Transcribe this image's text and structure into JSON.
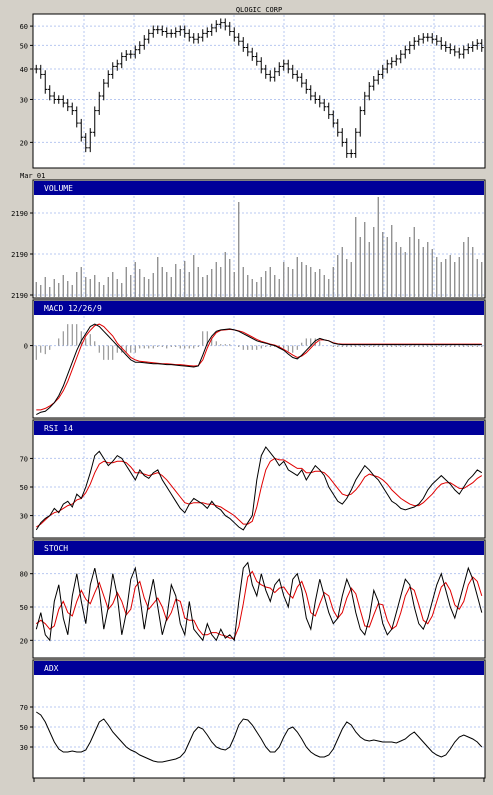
{
  "title": "QLOGIC CORP",
  "x_start_label": "Mar 01",
  "colors": {
    "panel_bg": "#ffffff",
    "header_bg": "#000099",
    "header_text": "#ffffff",
    "grid": "#b8c8f0",
    "price": "#000000",
    "signal": "#e00000",
    "volume": "#808080",
    "frame_bg": "#d4d0c8"
  },
  "chart_data": [
    {
      "type": "line",
      "name": "price",
      "style": "ohlc-bars",
      "title": "QLOGIC CORP",
      "yscale": "log",
      "ylim": [
        16,
        66
      ],
      "yticks": [
        20,
        30,
        40,
        50,
        60
      ],
      "x_count": 100,
      "values": [
        40,
        38,
        33,
        31,
        30,
        30,
        29,
        28,
        27,
        24,
        21,
        19,
        22,
        27,
        31,
        35,
        38,
        41,
        42,
        45,
        46,
        46,
        48,
        50,
        53,
        56,
        58,
        58,
        57,
        56,
        56,
        57,
        58,
        56,
        54,
        53,
        54,
        56,
        57,
        59,
        61,
        62,
        60,
        57,
        54,
        52,
        49,
        47,
        45,
        43,
        40,
        38,
        37,
        39,
        41,
        42,
        40,
        38,
        37,
        35,
        33,
        31,
        30,
        29,
        28,
        26,
        24,
        22,
        20,
        18,
        18,
        22,
        27,
        31,
        34,
        36,
        38,
        40,
        42,
        43,
        44,
        46,
        48,
        50,
        52,
        53,
        54,
        54,
        53,
        52,
        50,
        49,
        48,
        47,
        46,
        48,
        49,
        50,
        51,
        49
      ]
    },
    {
      "type": "bar",
      "name": "volume",
      "header": "VOLUME",
      "yticks": [
        "2190",
        "2190",
        "2190"
      ],
      "x_count": 100,
      "values": [
        0.15,
        0.12,
        0.2,
        0.1,
        0.18,
        0.14,
        0.22,
        0.16,
        0.12,
        0.25,
        0.3,
        0.2,
        0.18,
        0.22,
        0.15,
        0.12,
        0.2,
        0.25,
        0.18,
        0.14,
        0.3,
        0.22,
        0.35,
        0.28,
        0.2,
        0.18,
        0.24,
        0.4,
        0.3,
        0.25,
        0.2,
        0.33,
        0.28,
        0.36,
        0.25,
        0.42,
        0.3,
        0.2,
        0.22,
        0.28,
        0.35,
        0.3,
        0.45,
        0.38,
        0.25,
        0.95,
        0.3,
        0.22,
        0.18,
        0.15,
        0.2,
        0.26,
        0.3,
        0.22,
        0.18,
        0.35,
        0.3,
        0.28,
        0.4,
        0.35,
        0.32,
        0.3,
        0.25,
        0.28,
        0.22,
        0.18,
        0.3,
        0.42,
        0.5,
        0.38,
        0.35,
        0.8,
        0.6,
        0.75,
        0.55,
        0.7,
        1.0,
        0.65,
        0.6,
        0.72,
        0.55,
        0.5,
        0.45,
        0.6,
        0.7,
        0.58,
        0.5,
        0.55,
        0.48,
        0.4,
        0.35,
        0.38,
        0.42,
        0.35,
        0.4,
        0.55,
        0.6,
        0.5,
        0.38,
        0.35
      ]
    },
    {
      "type": "line",
      "name": "macd",
      "header": "MACD 12/26/9",
      "ylim": [
        -1.5,
        0.6
      ],
      "yticks": [
        0
      ],
      "ytick_labels": [
        "0"
      ],
      "x_count": 100,
      "series": [
        {
          "name": "macd",
          "color": "#000000",
          "values": [
            -1.45,
            -1.4,
            -1.38,
            -1.3,
            -1.2,
            -1.05,
            -0.85,
            -0.6,
            -0.35,
            -0.1,
            0.1,
            0.25,
            0.4,
            0.45,
            0.4,
            0.3,
            0.2,
            0.1,
            0.0,
            -0.1,
            -0.2,
            -0.3,
            -0.35,
            -0.35,
            -0.36,
            -0.37,
            -0.38,
            -0.38,
            -0.39,
            -0.4,
            -0.4,
            -0.41,
            -0.42,
            -0.43,
            -0.44,
            -0.45,
            -0.43,
            -0.2,
            0.05,
            0.2,
            0.3,
            0.33,
            0.34,
            0.35,
            0.33,
            0.3,
            0.25,
            0.2,
            0.15,
            0.1,
            0.07,
            0.05,
            0.02,
            0.0,
            -0.05,
            -0.1,
            -0.18,
            -0.25,
            -0.28,
            -0.2,
            -0.1,
            0.0,
            0.1,
            0.15,
            0.12,
            0.1,
            0.05,
            0.03,
            0.02,
            0.02,
            0.02,
            0.02,
            0.02,
            0.02,
            0.02,
            0.02,
            0.02,
            0.02,
            0.02,
            0.02,
            0.02,
            0.02,
            0.02,
            0.02,
            0.02,
            0.02,
            0.02,
            0.02,
            0.02,
            0.02,
            0.02,
            0.02,
            0.02,
            0.02,
            0.02,
            0.02,
            0.02,
            0.02,
            0.02,
            0.02
          ]
        },
        {
          "name": "signal",
          "color": "#e00000",
          "values": [
            -1.35,
            -1.35,
            -1.32,
            -1.27,
            -1.2,
            -1.1,
            -0.95,
            -0.75,
            -0.5,
            -0.25,
            0.0,
            0.2,
            0.32,
            0.42,
            0.45,
            0.4,
            0.3,
            0.2,
            0.05,
            -0.05,
            -0.15,
            -0.25,
            -0.3,
            -0.33,
            -0.34,
            -0.35,
            -0.36,
            -0.37,
            -0.38,
            -0.38,
            -0.39,
            -0.4,
            -0.4,
            -0.41,
            -0.42,
            -0.43,
            -0.42,
            -0.3,
            -0.05,
            0.15,
            0.27,
            0.32,
            0.33,
            0.34,
            0.33,
            0.31,
            0.28,
            0.23,
            0.18,
            0.13,
            0.09,
            0.06,
            0.03,
            0.01,
            -0.03,
            -0.08,
            -0.14,
            -0.2,
            -0.25,
            -0.22,
            -0.15,
            -0.05,
            0.05,
            0.12,
            0.12,
            0.1,
            0.06,
            0.04,
            0.03,
            0.03,
            0.03,
            0.03,
            0.03,
            0.03,
            0.03,
            0.03,
            0.03,
            0.03,
            0.03,
            0.03,
            0.03,
            0.03,
            0.03,
            0.03,
            0.03,
            0.03,
            0.03,
            0.03,
            0.03,
            0.03,
            0.03,
            0.03,
            0.03,
            0.03,
            0.03,
            0.03,
            0.03,
            0.03,
            0.03,
            0.03
          ]
        }
      ]
    },
    {
      "type": "line",
      "name": "rsi",
      "header": "RSI 14",
      "ylim": [
        15,
        85
      ],
      "yticks": [
        30,
        50,
        70
      ],
      "x_count": 100,
      "series": [
        {
          "name": "rsi",
          "color": "#000000",
          "values": [
            20,
            25,
            28,
            30,
            35,
            32,
            38,
            40,
            36,
            45,
            42,
            50,
            60,
            72,
            75,
            70,
            65,
            68,
            72,
            70,
            65,
            60,
            55,
            62,
            58,
            56,
            60,
            62,
            55,
            50,
            45,
            40,
            35,
            32,
            38,
            42,
            40,
            38,
            35,
            40,
            36,
            34,
            30,
            28,
            25,
            22,
            20,
            25,
            30,
            55,
            72,
            78,
            74,
            70,
            65,
            68,
            62,
            60,
            58,
            62,
            55,
            60,
            65,
            62,
            58,
            50,
            45,
            40,
            38,
            42,
            48,
            55,
            60,
            65,
            62,
            58,
            55,
            50,
            45,
            40,
            38,
            35,
            34,
            35,
            36,
            38,
            42,
            48,
            52,
            55,
            58,
            55,
            52,
            48,
            45,
            50,
            55,
            58,
            62,
            60
          ]
        },
        {
          "name": "signal",
          "color": "#e00000",
          "values": [
            22,
            24,
            27,
            30,
            32,
            33,
            35,
            37,
            38,
            41,
            42,
            46,
            52,
            60,
            66,
            68,
            67,
            67,
            68,
            68,
            67,
            64,
            60,
            60,
            59,
            58,
            59,
            60,
            58,
            55,
            51,
            47,
            43,
            39,
            38,
            39,
            39,
            39,
            38,
            38,
            37,
            36,
            34,
            32,
            30,
            27,
            24,
            24,
            26,
            36,
            50,
            62,
            68,
            70,
            69,
            69,
            67,
            65,
            63,
            63,
            60,
            60,
            61,
            61,
            60,
            57,
            53,
            49,
            45,
            44,
            45,
            48,
            52,
            57,
            59,
            58,
            57,
            55,
            52,
            48,
            45,
            42,
            40,
            38,
            37,
            37,
            39,
            42,
            45,
            49,
            52,
            53,
            53,
            51,
            49,
            49,
            51,
            53,
            56,
            58
          ]
        }
      ]
    },
    {
      "type": "line",
      "name": "stochastic",
      "header": "STOCH",
      "ylim": [
        5,
        95
      ],
      "yticks": [
        20,
        50,
        80
      ],
      "x_count": 100,
      "series": [
        {
          "name": "%K",
          "color": "#000000",
          "values": [
            30,
            45,
            25,
            20,
            55,
            70,
            40,
            25,
            60,
            80,
            55,
            35,
            70,
            85,
            65,
            30,
            50,
            80,
            60,
            25,
            45,
            75,
            85,
            60,
            30,
            55,
            75,
            50,
            25,
            40,
            70,
            60,
            35,
            25,
            55,
            30,
            25,
            20,
            35,
            25,
            20,
            30,
            22,
            25,
            20,
            55,
            85,
            90,
            70,
            60,
            80,
            65,
            55,
            70,
            75,
            60,
            50,
            75,
            80,
            65,
            40,
            30,
            55,
            75,
            60,
            45,
            35,
            40,
            60,
            75,
            65,
            45,
            30,
            25,
            40,
            65,
            55,
            35,
            25,
            30,
            45,
            60,
            75,
            70,
            50,
            35,
            30,
            40,
            55,
            70,
            80,
            65,
            50,
            40,
            55,
            70,
            85,
            75,
            60,
            45
          ]
        },
        {
          "name": "%D",
          "color": "#e00000",
          "values": [
            35,
            38,
            35,
            30,
            33,
            48,
            55,
            45,
            42,
            55,
            65,
            57,
            53,
            63,
            72,
            60,
            48,
            53,
            63,
            55,
            43,
            48,
            68,
            73,
            58,
            48,
            53,
            58,
            50,
            38,
            45,
            57,
            55,
            40,
            38,
            38,
            30,
            25,
            25,
            27,
            27,
            25,
            24,
            22,
            22,
            32,
            53,
            77,
            82,
            73,
            70,
            68,
            67,
            63,
            67,
            68,
            62,
            58,
            68,
            73,
            62,
            45,
            42,
            53,
            63,
            60,
            47,
            40,
            45,
            58,
            67,
            62,
            47,
            33,
            32,
            43,
            53,
            52,
            38,
            30,
            33,
            45,
            60,
            68,
            65,
            52,
            38,
            35,
            42,
            55,
            68,
            72,
            65,
            52,
            48,
            55,
            70,
            77,
            73,
            60
          ]
        }
      ]
    },
    {
      "type": "line",
      "name": "adx",
      "header": "ADX",
      "ylim": [
        0,
        100
      ],
      "yticks": [
        30,
        50,
        70
      ],
      "x_count": 100,
      "series": [
        {
          "name": "adx",
          "color": "#000000",
          "values": [
            65,
            62,
            55,
            45,
            35,
            28,
            25,
            25,
            26,
            25,
            25,
            27,
            35,
            45,
            55,
            58,
            52,
            45,
            40,
            35,
            30,
            27,
            25,
            22,
            20,
            18,
            16,
            15,
            15,
            16,
            17,
            18,
            20,
            25,
            35,
            45,
            50,
            48,
            42,
            35,
            30,
            28,
            27,
            30,
            40,
            52,
            58,
            57,
            52,
            45,
            38,
            30,
            25,
            25,
            30,
            40,
            48,
            50,
            45,
            38,
            30,
            25,
            22,
            20,
            20,
            22,
            28,
            38,
            48,
            55,
            52,
            45,
            40,
            37,
            36,
            37,
            36,
            35,
            35,
            35,
            34,
            36,
            38,
            42,
            45,
            40,
            35,
            30,
            25,
            22,
            20,
            22,
            28,
            35,
            40,
            42,
            40,
            38,
            35,
            30
          ]
        }
      ]
    }
  ]
}
